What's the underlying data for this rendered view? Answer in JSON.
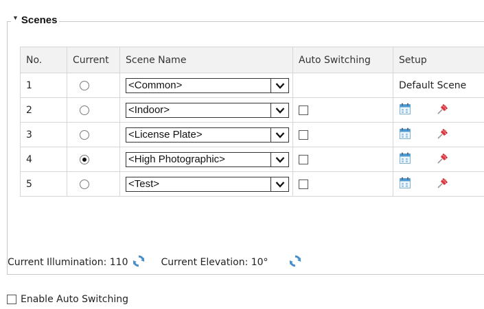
{
  "section": {
    "title": "Scenes"
  },
  "table": {
    "headers": [
      "No.",
      "Current",
      "Scene Name",
      "Auto Switching",
      "Setup"
    ],
    "rows": [
      {
        "no": "1",
        "current": false,
        "scene": "<Common>",
        "auto": null,
        "setup": "Default Scene"
      },
      {
        "no": "2",
        "current": false,
        "scene": "<Indoor>",
        "auto": false,
        "setup": "icons"
      },
      {
        "no": "3",
        "current": false,
        "scene": "<License Plate>",
        "auto": false,
        "setup": "icons"
      },
      {
        "no": "4",
        "current": true,
        "scene": "<High Photographic>",
        "auto": false,
        "setup": "icons"
      },
      {
        "no": "5",
        "current": false,
        "scene": "<Test>",
        "auto": false,
        "setup": "icons"
      }
    ]
  },
  "status": {
    "illumination_label": "Current Illumination: 110",
    "elevation_label": "Current Elevation: 10°"
  },
  "enable_auto_switching": {
    "label": "Enable Auto Switching",
    "checked": false
  },
  "icons": {
    "section_toggle": "triangle-down-icon",
    "dropdown": "chevron-down-icon",
    "schedule": "calendar-icon",
    "pin": "pushpin-icon",
    "refresh": "refresh-icon"
  },
  "colors": {
    "header_bg": "#f2f2f2",
    "border": "#d6d6d6",
    "pin": "#d9363e",
    "refresh": "#4a8fc7"
  }
}
